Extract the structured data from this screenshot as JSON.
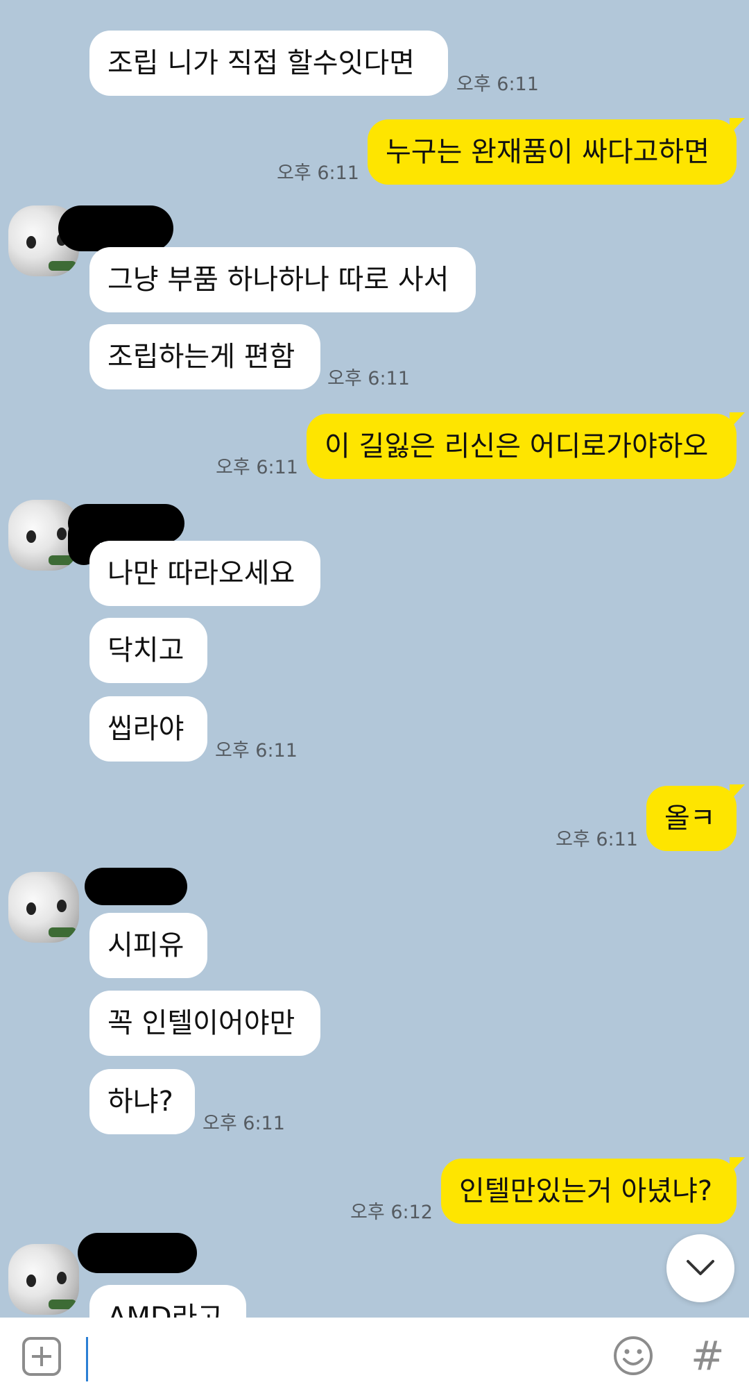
{
  "messages": [
    {
      "text": "조립  니가 직접 할수잇다면",
      "time": "오후 6:11"
    },
    {
      "text": "누구는 완재품이 싸다고하면",
      "time": "오후 6:11"
    },
    {
      "text": "그냥 부품 하나하나 따로 사서"
    },
    {
      "text": "조립하는게 편함",
      "time": "오후 6:11"
    },
    {
      "text": "이 길잃은 리신은 어디로가야하오",
      "time": "오후 6:11"
    },
    {
      "text": "나만 따라오세요"
    },
    {
      "text": "닥치고"
    },
    {
      "text": "씹라야",
      "time": "오후 6:11"
    },
    {
      "text": "올ㅋ",
      "time": "오후 6:11"
    },
    {
      "text": "시피유"
    },
    {
      "text": "꼭 인텔이어야만"
    },
    {
      "text": "하냐?",
      "time": "오후 6:11"
    },
    {
      "text": "인텔만있는거 아녔냐?",
      "time": "오후 6:12"
    },
    {
      "text": "AMD라고"
    }
  ],
  "input": {
    "value": "",
    "placeholder": ""
  },
  "colors": {
    "background": "#b2c7d9",
    "outgoing_bubble": "#fee500",
    "incoming_bubble": "#ffffff"
  },
  "icons": {
    "attach": "plus-square-icon",
    "emoji": "smiley-icon",
    "hashtag": "hash-icon",
    "scroll_down": "chevron-down-icon"
  }
}
